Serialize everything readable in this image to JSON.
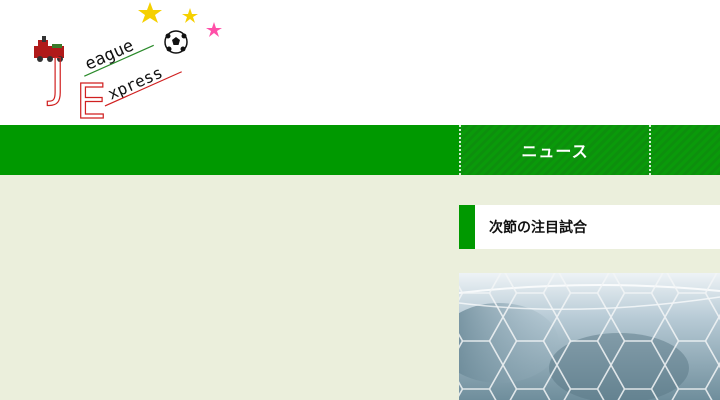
{
  "logo": {
    "line1": "eague",
    "line2": "xpress",
    "initial1": "J",
    "initial2": "E",
    "alt": "J League Express"
  },
  "nav": {
    "items": [
      {
        "label": "ニュース"
      }
    ]
  },
  "sidebar": {
    "heading": "次節の注目試合"
  },
  "colors": {
    "brand_green": "#009900",
    "page_background": "#ebefdc"
  }
}
